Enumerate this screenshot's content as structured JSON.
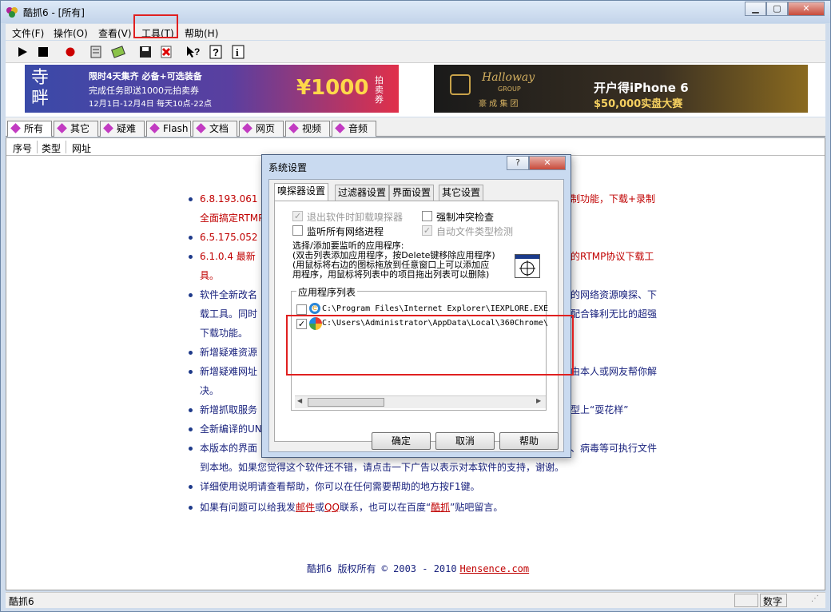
{
  "window": {
    "title": "酷抓6 - [所有]"
  },
  "menu": [
    "文件(F)",
    "操作(O)",
    "查看(V)",
    "工具(T)",
    "帮助(H)"
  ],
  "ads": {
    "left_line1": "限时4天集齐 必备+可选装备",
    "left_line2": "完成任务即送1000元拍卖券",
    "left_line3": "12月1日-12月4日  每天10点-22点",
    "left_big": "¥1000",
    "left_unit": "拍卖券",
    "right_brand": "Halloway",
    "right_group": "GROUP",
    "right_cn": "豪 成 集 团",
    "right_line1": "开户得iPhone 6",
    "right_line2": "$50,000实盘大赛"
  },
  "tabs": [
    "所有",
    "其它",
    "疑难",
    "Flash",
    "文档",
    "网页",
    "视频",
    "音频"
  ],
  "columns": [
    "序号",
    "类型",
    "网址"
  ],
  "news": [
    {
      "text": "6.8.193.061",
      "tail": "制功能，下载+录制",
      "color": "red"
    },
    {
      "text": "全面搞定RTMP",
      "color": "red",
      "cont": true
    },
    {
      "text": "6.5.175.052",
      "color": "red"
    },
    {
      "text": "6.1.0.4 最新",
      "tail": "的RTMP协议下载工",
      "color": "red"
    },
    {
      "text": "具。",
      "color": "red",
      "cont": true
    },
    {
      "text": "软件全新改名",
      "tail": "的网络资源嗅探、下",
      "color": "blue"
    },
    {
      "text": "载工具。同时",
      "tail": "配合锋利无比的超强",
      "color": "blue",
      "cont": true
    },
    {
      "text": "下载功能。",
      "color": "blue",
      "cont": true
    },
    {
      "text": "新增疑难资源",
      "color": "blue"
    },
    {
      "text": "新增疑难网址",
      "tail": "由本人或网友帮你解",
      "color": "blue"
    },
    {
      "text": "决。",
      "color": "blue",
      "cont": true
    },
    {
      "text": "新增抓取服务",
      "tail": "型上“耍花样”",
      "color": "blue"
    },
    {
      "text": "全新编译的UN",
      "color": "blue"
    },
    {
      "text": "本版本的界面",
      "tail": "、病毒等可执行文件",
      "color": "blue"
    },
    {
      "text": "到本地。如果您觉得这个软件还不错，请点击一下广告以表示对本软件的支持，谢谢。",
      "color": "blue",
      "cont": true
    },
    {
      "text": "详细使用说明请查看帮助，你可以在任何需要帮助的地方按F1键。",
      "color": "blue"
    }
  ],
  "contact": {
    "pre": "如果有问题可以给我发",
    "mail": "邮件",
    "or": "或",
    "qq": "QQ",
    "mid": "联系，也可以在百度“",
    "bar": "酷抓",
    "post": "”贴吧留言。"
  },
  "copyright": {
    "text": "酷抓6 版权所有 © 2003 - 2010",
    "link": "Hensence.com"
  },
  "status": {
    "left": "酷抓6",
    "right": "数字"
  },
  "dialog": {
    "title": "系统设置",
    "tabs": [
      "嗅探器设置",
      "过滤器设置",
      "界面设置",
      "其它设置"
    ],
    "options": [
      {
        "label": "退出软件时卸载嗅探器",
        "checked": true,
        "disabled": true
      },
      {
        "label": "强制冲突检查",
        "checked": false,
        "disabled": false
      },
      {
        "label": "监听所有网络进程",
        "checked": false,
        "disabled": false
      },
      {
        "label": "自动文件类型检测",
        "checked": true,
        "disabled": true
      }
    ],
    "help1": "选择/添加要监听的应用程序:",
    "help2": "(双击列表添加应用程序，按Delete键移除应用程序)",
    "help3": "(用鼠标将右边的图标拖放到任意窗口上可以添加应",
    "help4": "用程序，用鼠标将列表中的项目拖出列表可以删除)",
    "list_title": "应用程序列表",
    "apps": [
      {
        "path": "C:\\Program Files\\Internet Explorer\\IEXPLORE.EXE",
        "checked": false
      },
      {
        "path": "C:\\Users\\Administrator\\AppData\\Local\\360Chrome\\",
        "checked": true
      }
    ],
    "buttons": {
      "ok": "确定",
      "cancel": "取消",
      "help": "帮助"
    }
  }
}
